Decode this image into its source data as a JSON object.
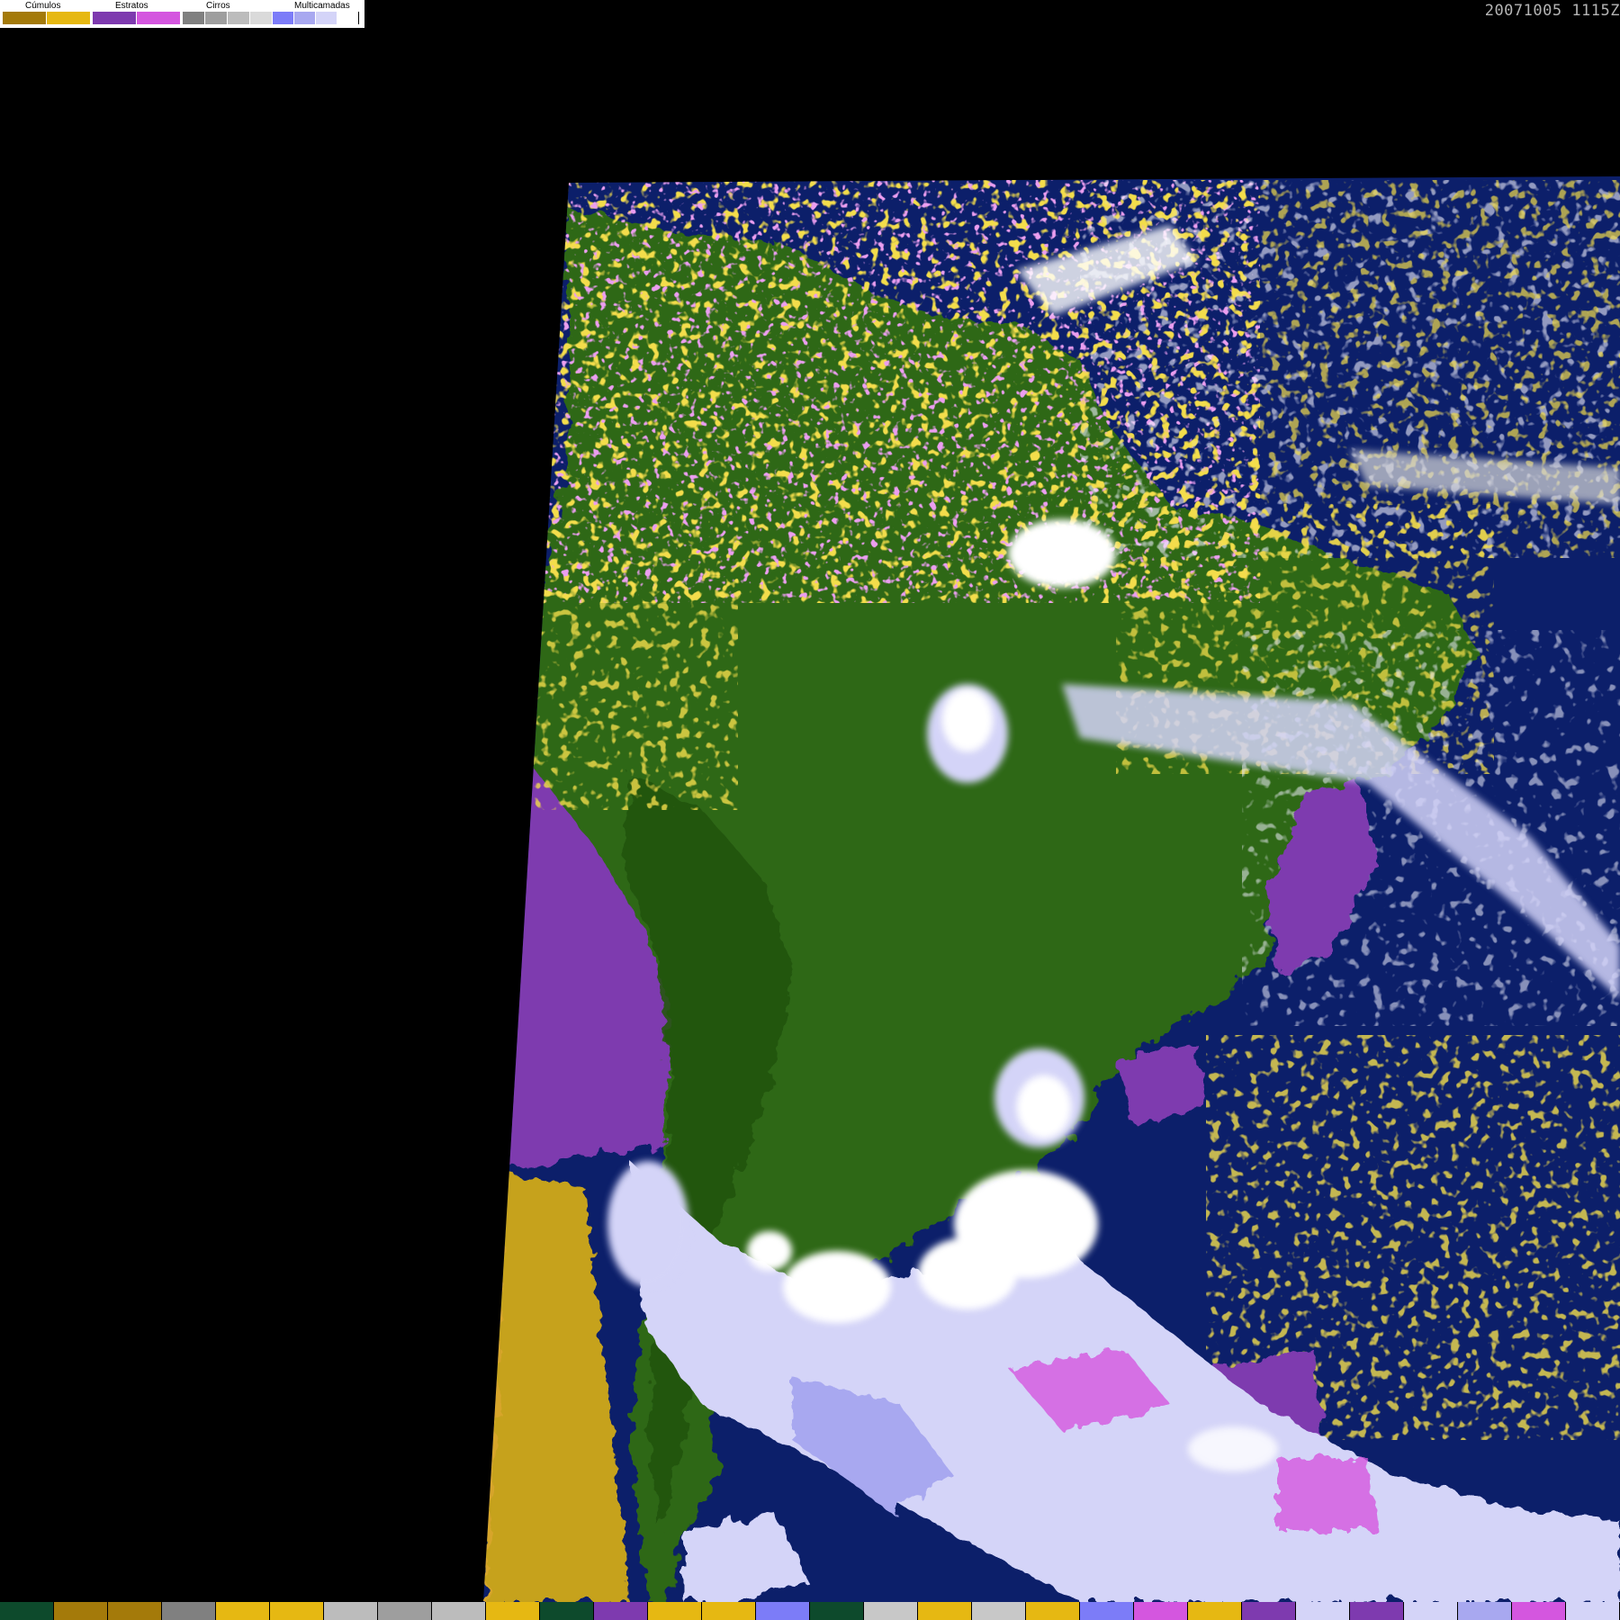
{
  "timestamp": "20071005 1115Z",
  "legend": {
    "groups": [
      {
        "label": "Cúmulos",
        "colors": [
          "#a47a0a",
          "#e6b812"
        ]
      },
      {
        "label": "Estratos",
        "colors": [
          "#7e3aaf",
          "#d456df"
        ]
      },
      {
        "label": "Cirros",
        "colors": [
          "#808080",
          "#9e9e9e",
          "#bcbcbc",
          "#dadada"
        ]
      },
      {
        "label": "Multicamadas",
        "colors": [
          "#7c7cf8",
          "#a8a8f0",
          "#d4d4f8",
          "#ffffff"
        ]
      }
    ]
  },
  "colors": {
    "background": "#000000",
    "ocean": "#0c1f6a",
    "land": "#2f6718",
    "land_dark": "#24540f",
    "stratus": "#7e3aaf",
    "stratus_light": "#d456df",
    "cumulus": "#e6b812",
    "cumulus_dark": "#a47a0a",
    "multilayer": "#d4d4f8",
    "multilayer_mid": "#a8a8f0",
    "cloud_white": "#ffffff",
    "cirrus": "#bcbcbc"
  },
  "bottom_strip_colors": [
    "#0d4a2c",
    "#a47a0a",
    "#a47a0a",
    "#808080",
    "#e6b812",
    "#e6b812",
    "#bcbcbc",
    "#9e9e9e",
    "#bcbcbc",
    "#e6b812",
    "#0d4a2c",
    "#7e3aaf",
    "#e6b812",
    "#e6b812",
    "#7c7cf8",
    "#0d4a2c",
    "#c8c8c8",
    "#e6b812",
    "#c8c8c8",
    "#e6b812",
    "#7c7cf8",
    "#d456df",
    "#e6b812",
    "#7e3aaf",
    "#d4d4f8",
    "#7e3aaf",
    "#d4d4f8",
    "#a8a8f0",
    "#d456df",
    "#d4d4f8"
  ]
}
